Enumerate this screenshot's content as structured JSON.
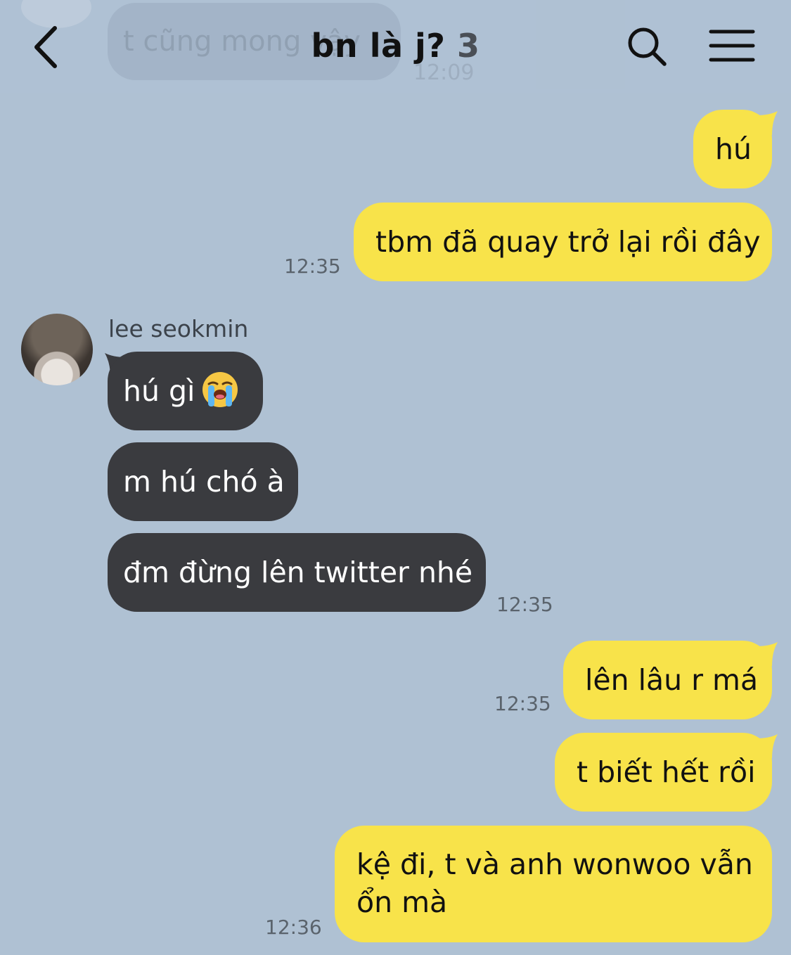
{
  "header": {
    "title": "bn là j?",
    "member_count": "3",
    "ghost_message": "t cũng mong vậy",
    "ghost_time": "12:09"
  },
  "icons": {
    "back": "chevron-left-icon",
    "search": "search-icon",
    "menu": "hamburger-menu-icon",
    "emoji": "loudly-crying-face-emoji"
  },
  "colors": {
    "background": "#afc1d3",
    "my_bubble": "#f8e34a",
    "their_bubble": "#3a3b3f"
  },
  "messages": {
    "m1": {
      "text": "hú"
    },
    "m2": {
      "text": "tbm đã quay trở lại rồi đây",
      "time": "12:35"
    },
    "sender": {
      "name": "lee seokmin"
    },
    "m3": {
      "text": "hú gì"
    },
    "m4": {
      "text": "m hú chó à"
    },
    "m5": {
      "text": "đm đừng lên twitter nhé",
      "time": "12:35"
    },
    "m6": {
      "text": "lên lâu r má",
      "time": "12:35"
    },
    "m7": {
      "text": "t biết hết rồi"
    },
    "m8": {
      "line1": "kệ đi, t và anh wonwoo vẫn",
      "line2": "ổn mà",
      "time": "12:36"
    }
  }
}
